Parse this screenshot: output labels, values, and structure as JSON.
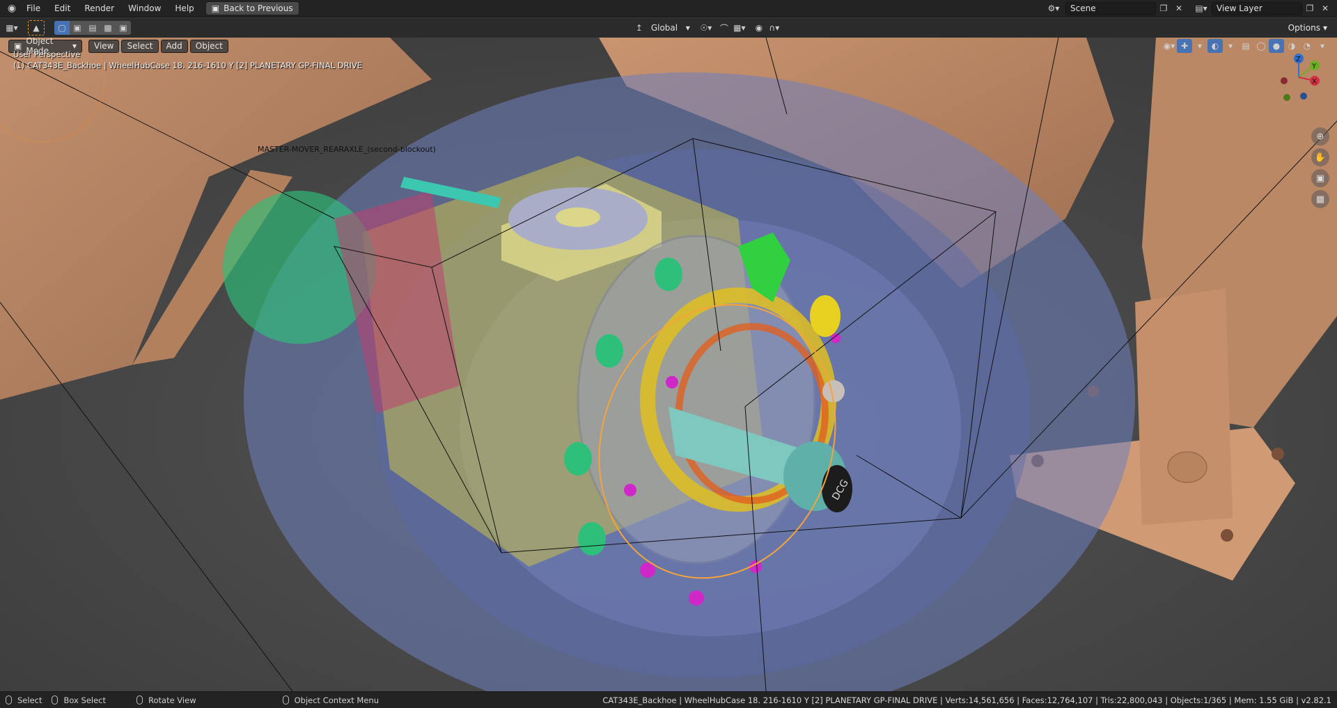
{
  "menu": {
    "file": "File",
    "edit": "Edit",
    "render": "Render",
    "window": "Window",
    "help": "Help",
    "back_button": "Back to Previous"
  },
  "scene": {
    "label": "Scene",
    "view_layer": "View Layer"
  },
  "toolbar": {
    "orientation": "Global",
    "options": "Options"
  },
  "viewport_header": {
    "mode": "Object Mode",
    "view": "View",
    "select": "Select",
    "add": "Add",
    "object": "Object"
  },
  "overlay": {
    "perspective": "User Perspective",
    "object_info": "(1) CAT343E_Backhoe | WheelHubCase  18. 216-1610 Y [2] PLANETARY GP-FINAL DRIVE",
    "object_label": "MASTER-MOVER_REARAXLE_(second-blockout)",
    "hub_cap_text": "DCG"
  },
  "gizmo": {
    "x": "X",
    "y": "Y",
    "z": "Z"
  },
  "status": {
    "select": "Select",
    "box_select": "Box Select",
    "rotate_view": "Rotate View",
    "context_menu": "Object Context Menu",
    "info": "CAT343E_Backhoe | WheelHubCase  18. 216-1610 Y [2] PLANETARY GP-FINAL DRIVE | Verts:14,561,656 | Faces:12,764,107 | Tris:22,800,043 | Objects:1/365 | Mem: 1.55 GiB | v2.82.1"
  },
  "colors": {
    "bg_dark": "#232323",
    "viewport": "#474747",
    "accent_blue": "#4772b3",
    "selection_orange": "#f5a33a",
    "tan": "#c4906a",
    "glass_blue": "#6e7fc0"
  }
}
